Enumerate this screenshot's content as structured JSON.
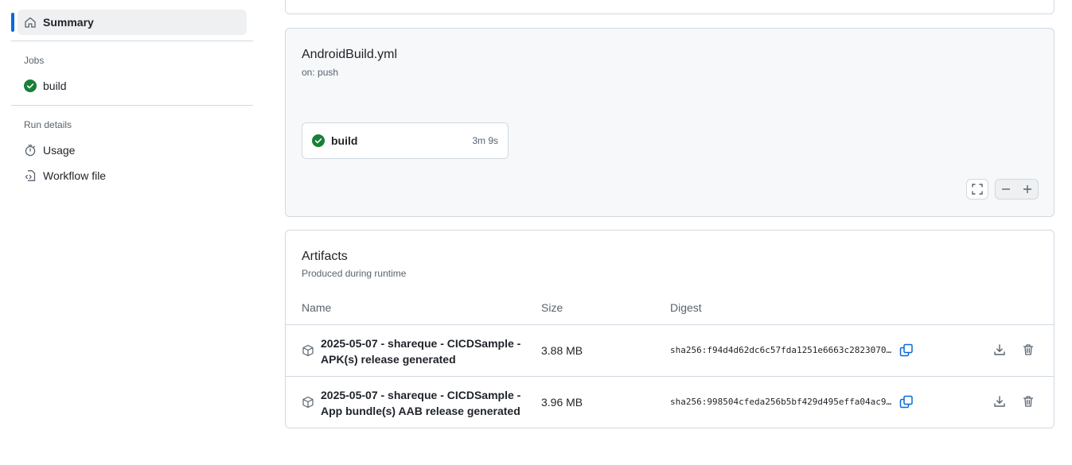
{
  "sidebar": {
    "summary_label": "Summary",
    "jobs_heading": "Jobs",
    "job_label": "build",
    "run_details_heading": "Run details",
    "usage_label": "Usage",
    "workflow_file_label": "Workflow file"
  },
  "workflow": {
    "file_name": "AndroidBuild.yml",
    "trigger": "on: push",
    "job_name": "build",
    "job_duration": "3m 9s"
  },
  "artifacts": {
    "title": "Artifacts",
    "subtitle": "Produced during runtime",
    "columns": {
      "name": "Name",
      "size": "Size",
      "digest": "Digest"
    },
    "rows": [
      {
        "name": "2025-05-07 - shareque - CICDSample - APK(s) release generated",
        "size": "3.88 MB",
        "digest": "sha256:f94d4d62dc6c57fda1251e6663c2823070…"
      },
      {
        "name": "2025-05-07 - shareque - CICDSample - App bundle(s) AAB release generated",
        "size": "3.96 MB",
        "digest": "sha256:998504cfeda256b5bf429d495effa04ac9…"
      }
    ]
  },
  "colors": {
    "accent": "#0969da",
    "success": "#1a7f37",
    "border": "#d1d9e0",
    "muted": "#59636e"
  }
}
